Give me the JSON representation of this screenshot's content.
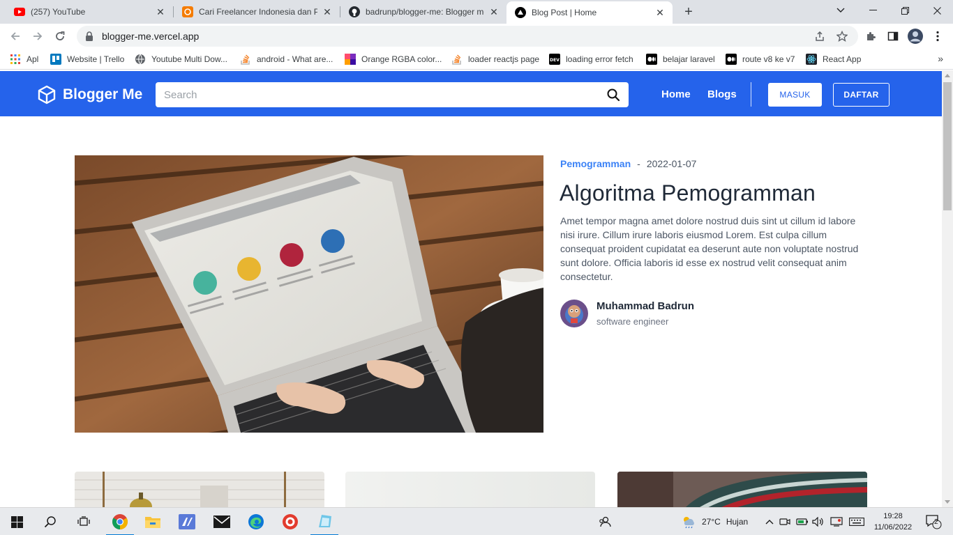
{
  "browser": {
    "tabs": [
      {
        "title": "(257) YouTube",
        "icon": "youtube-icon"
      },
      {
        "title": "Cari Freelancer Indonesia dan Pekerjaan",
        "icon": "projects-icon"
      },
      {
        "title": "badrunp/blogger-me: Blogger me",
        "icon": "github-icon"
      },
      {
        "title": "Blog Post | Home",
        "icon": "vercel-icon",
        "active": true
      }
    ],
    "url": "blogger-me.vercel.app",
    "bookmarks": [
      {
        "label": "Apl",
        "icon": "apps-grid-icon"
      },
      {
        "label": "Website | Trello",
        "icon": "trello-icon"
      },
      {
        "label": "Youtube Multi Dow...",
        "icon": "globe-icon"
      },
      {
        "label": "android - What are...",
        "icon": "stackoverflow-icon"
      },
      {
        "label": "Orange RGBA color...",
        "icon": "color-icon"
      },
      {
        "label": "loader reactjs page",
        "icon": "stackoverflow-icon"
      },
      {
        "label": "loading error fetch",
        "icon": "dev-icon"
      },
      {
        "label": "belajar laravel",
        "icon": "medium-icon"
      },
      {
        "label": "route v8 ke v7",
        "icon": "medium-icon"
      },
      {
        "label": "React App",
        "icon": "react-icon"
      }
    ]
  },
  "site": {
    "brand": "Blogger Me",
    "search_placeholder": "Search",
    "nav": {
      "home": "Home",
      "blogs": "Blogs"
    },
    "buttons": {
      "login": "MASUK",
      "register": "DAFTAR"
    },
    "accent": "#2563eb",
    "featured": {
      "category": "Pemogramman",
      "separator": "-",
      "date": "2022-01-07",
      "title": "Algoritma Pemogramman",
      "excerpt": "Amet tempor magna amet dolore nostrud duis sint ut cillum id labore nisi irure. Cillum irure laboris eiusmod Lorem. Est culpa cillum consequat proident cupidatat ea deserunt aute non voluptate nostrud sunt dolore. Officia laboris id esse ex nostrud velit consequat anim consectetur.",
      "author": {
        "name": "Muhammad Badrun",
        "role": "software engineer"
      }
    }
  },
  "taskbar": {
    "weather": {
      "temp": "27°C",
      "condition": "Hujan"
    },
    "time": "19:28",
    "date": "11/06/2022",
    "notifications": "2"
  }
}
